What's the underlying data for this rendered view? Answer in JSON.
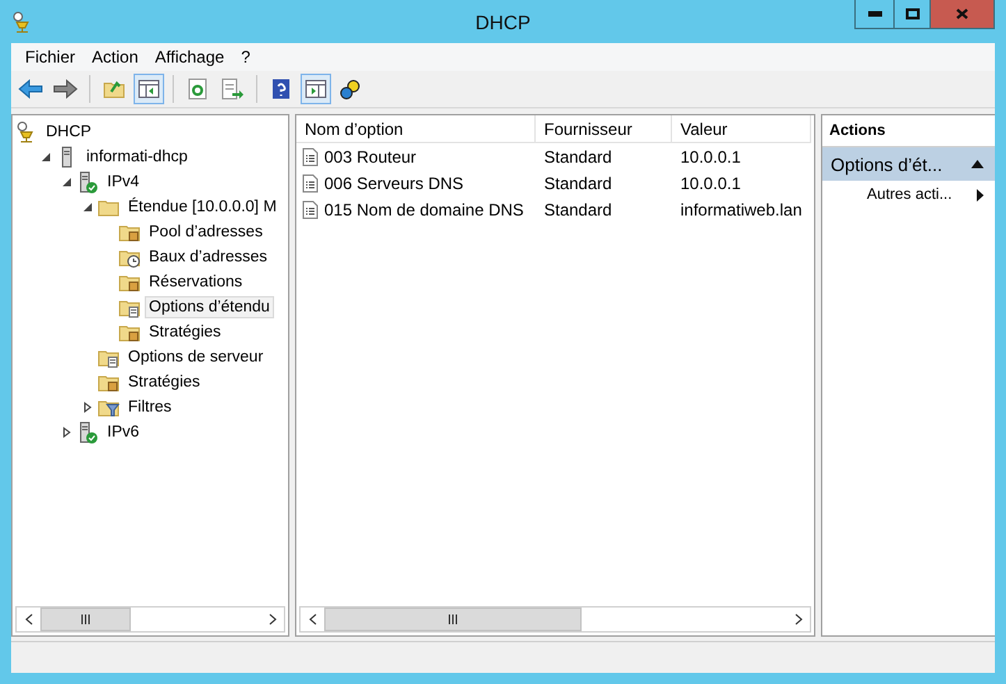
{
  "window": {
    "title": "DHCP"
  },
  "menu": [
    "Fichier",
    "Action",
    "Affichage",
    "?"
  ],
  "tree": [
    {
      "label": "DHCP",
      "kind": "dhcp",
      "selected": false,
      "children": [
        {
          "label": "informati-dhcp",
          "kind": "server",
          "expanded": true,
          "selected": false,
          "children": [
            {
              "label": "IPv4",
              "kind": "serverok",
              "expanded": true,
              "selected": false,
              "children": [
                {
                  "label": "Étendue [10.0.0.0] M",
                  "kind": "folder",
                  "expanded": true,
                  "selected": false,
                  "children": [
                    {
                      "label": "Pool d’adresses",
                      "kind": "pool",
                      "selected": false
                    },
                    {
                      "label": "Baux d’adresses",
                      "kind": "leases",
                      "selected": false
                    },
                    {
                      "label": "Réservations",
                      "kind": "pool",
                      "selected": false
                    },
                    {
                      "label": "Options d’étendu",
                      "kind": "options",
                      "selected": true
                    },
                    {
                      "label": "Stratégies",
                      "kind": "pool",
                      "selected": false
                    }
                  ]
                },
                {
                  "label": "Options de serveur",
                  "kind": "options",
                  "selected": false
                },
                {
                  "label": "Stratégies",
                  "kind": "pool",
                  "selected": false
                },
                {
                  "label": "Filtres",
                  "kind": "filter",
                  "expanded": false,
                  "selected": false
                }
              ]
            },
            {
              "label": "IPv6",
              "kind": "serverok",
              "expanded": false,
              "selected": false
            }
          ]
        }
      ]
    }
  ],
  "table": {
    "columns": [
      "Nom d’option",
      "Fournisseur",
      "Valeur"
    ],
    "rows": [
      [
        "003 Routeur",
        "Standard",
        "10.0.0.1"
      ],
      [
        "006 Serveurs DNS",
        "Standard",
        "10.0.0.1"
      ],
      [
        "015 Nom de domaine DNS",
        "Standard",
        "informatiweb.lan"
      ]
    ]
  },
  "actions": {
    "title": "Actions",
    "section": {
      "label": "Options d’ét...",
      "expanded": true
    },
    "items": [
      "Autres acti..."
    ]
  }
}
